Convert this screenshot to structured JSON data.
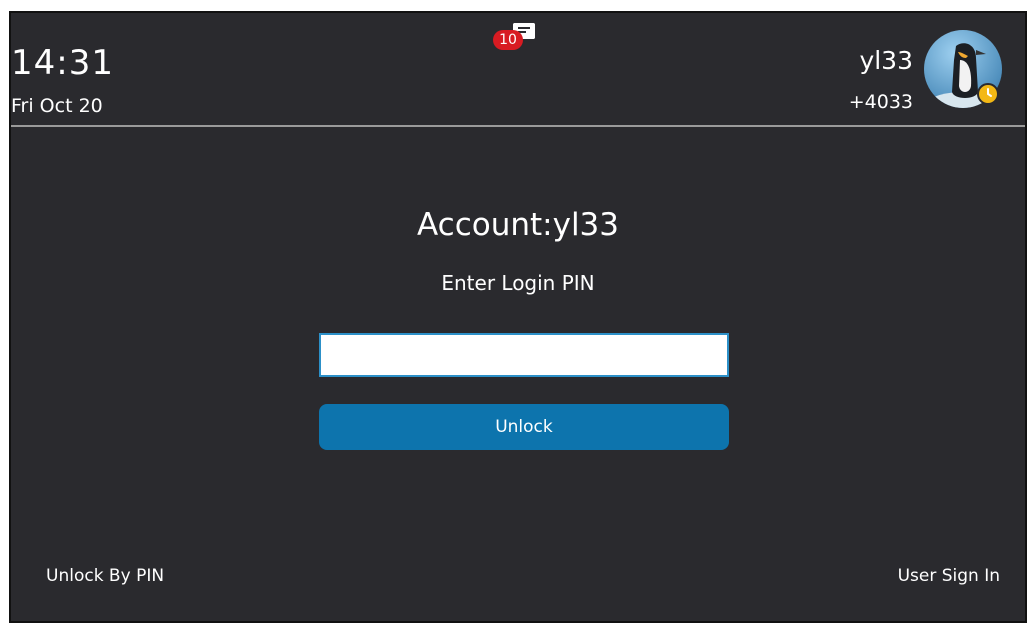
{
  "header": {
    "notification_count": "10",
    "time": "14:31",
    "date": "Fri Oct 20",
    "account_name": "yl33",
    "account_number": "+4033",
    "status_color": "#f3b815"
  },
  "main": {
    "title": "Account:yl33",
    "subtitle": "Enter Login PIN",
    "pin_value": "",
    "unlock_label": "Unlock"
  },
  "softkeys": {
    "left_label": "Unlock By PIN",
    "right_label": "User Sign In"
  },
  "icons": {
    "voicemail": "voicemail-icon",
    "avatar": "penguin-avatar",
    "status": "clock-status-icon"
  },
  "colors": {
    "background": "#2a2a2e",
    "accent": "#0d74ad",
    "badge": "#d81b22"
  }
}
